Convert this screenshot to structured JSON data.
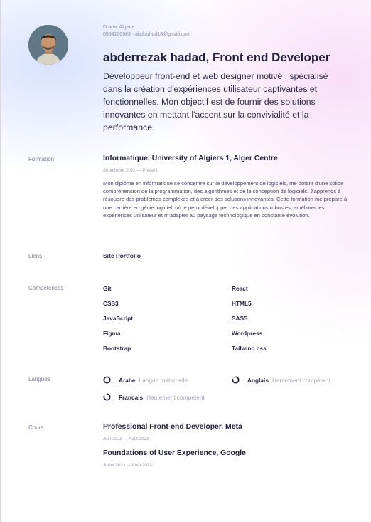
{
  "header": {
    "location": "Draria, Algerie",
    "contact_line": "0554100983 · abdouhdd18@gmail.com",
    "name": "abderrezak hadad, Front end Developer",
    "summary": "Développeur front-end et web designer motivé , spécialisé dans la création d'expériences utilisateur captivantes et fonctionnelles. Mon objectif est de fournir des solutions innovantes en mettant l'accent sur la convivialité et la performance."
  },
  "formation": {
    "label": "Formation",
    "title": "Informatique, University of Algiers 1, Alger Centre",
    "dates": "Septembre 2022 — Présent",
    "description": "Mon diplôme en informatique se concentre sur le développement de logiciels, me dotant d'une solide compréhension de la programmation, des algorithmes et de la conception de logiciels. J'apprends à résoudre des problèmes complexes et à créer des solutions innovantes. Cette formation me prépare à une carrière en génie logiciel, où je peux développer des applications robustes, améliorer les expériences utilisateur et m'adapter au paysage technologique en constante évolution."
  },
  "liens": {
    "label": "Liens",
    "link_text": "Site Portfolio"
  },
  "competences": {
    "label": "Compétences",
    "items": [
      "Git",
      "React",
      "CSS3",
      "HTML5",
      "JavaScript",
      "SASS",
      "Figma",
      "Wordpress",
      "Bootstrap",
      "Tailwind css"
    ]
  },
  "langues": {
    "label": "Langues",
    "items": [
      {
        "name": "Arabe",
        "level": "Langue maternelle",
        "proficiency": 1.0
      },
      {
        "name": "Anglais",
        "level": "Hautement compétent",
        "proficiency": 0.8
      },
      {
        "name": "Francais",
        "level": "Hautement compétent",
        "proficiency": 0.8
      }
    ]
  },
  "cours": {
    "label": "Cours",
    "items": [
      {
        "title": "Professional Front-end Developer, Meta",
        "dates": "Juin 2023 — Août 2023"
      },
      {
        "title": "Foundations of User Experience, Google",
        "dates": "Juillet 2023 — Août 2023"
      }
    ]
  },
  "colors": {
    "ring": "#1e1b3a",
    "ring_track": "#d8d8e4"
  }
}
